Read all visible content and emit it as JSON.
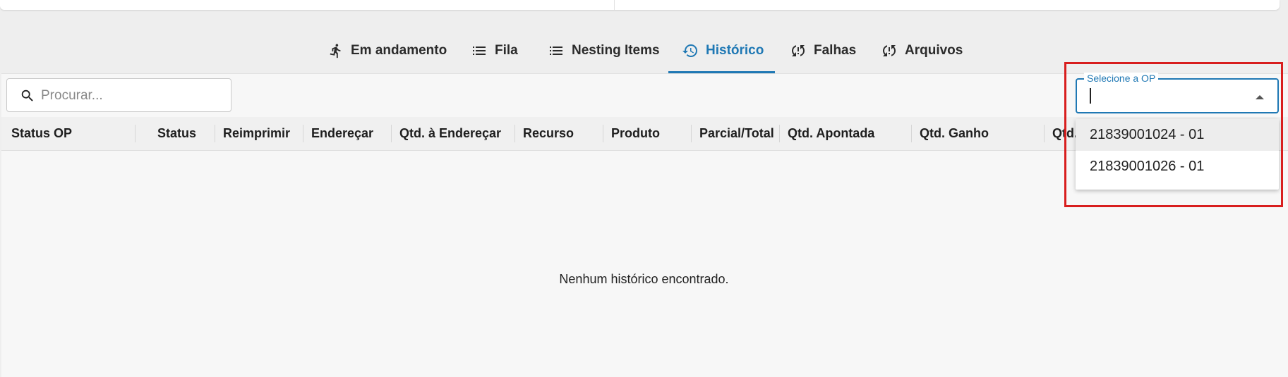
{
  "tabs": [
    {
      "label": "Em andamento",
      "icon": "runner-icon"
    },
    {
      "label": "Fila",
      "icon": "list-icon"
    },
    {
      "label": "Nesting Items",
      "icon": "list-icon"
    },
    {
      "label": "Histórico",
      "icon": "history-icon",
      "active": true
    },
    {
      "label": "Falhas",
      "icon": "sync-problem-icon"
    },
    {
      "label": "Arquivos",
      "icon": "sync-problem-icon"
    }
  ],
  "search": {
    "placeholder": "Procurar..."
  },
  "table": {
    "columns": [
      "Status OP",
      "Status",
      "Reimprimir",
      "Endereçar",
      "Qtd. à Endereçar",
      "Recurso",
      "Produto",
      "Parcial/Total",
      "Qtd. Apontada",
      "Qtd. Ganho",
      "Qtd."
    ],
    "empty_message": "Nenhum histórico encontrado."
  },
  "op_select": {
    "label": "Selecione a OP",
    "value": "",
    "options": [
      "21839001024 - 01",
      "21839001026 - 01"
    ]
  },
  "colors": {
    "accent": "#1f78b4",
    "highlight_border": "#d81e1e"
  }
}
